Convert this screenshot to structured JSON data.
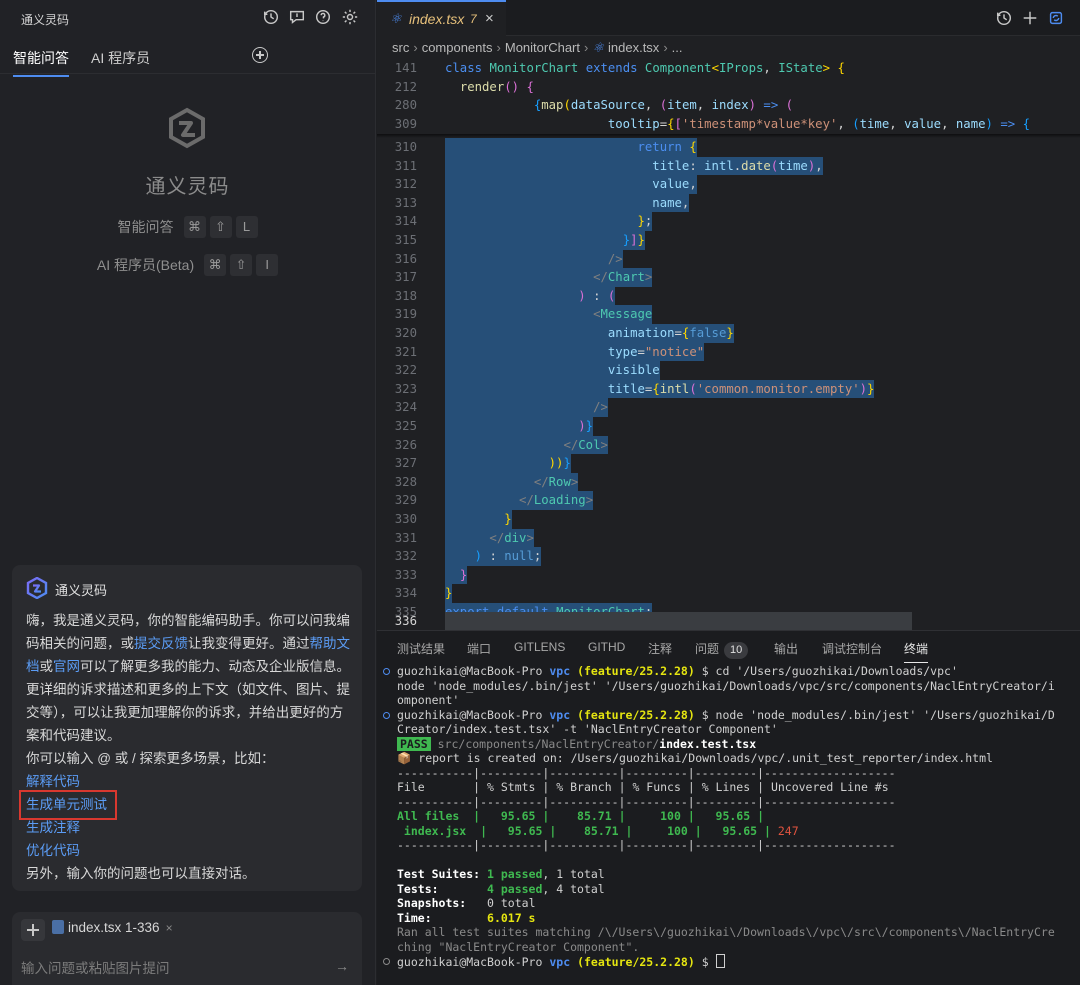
{
  "left_header": {
    "title": "通义灵码"
  },
  "left_tabs": [
    {
      "label": "智能问答"
    },
    {
      "label": "AI 程序员"
    }
  ],
  "welcome": {
    "title": "通义灵码",
    "shortcuts": [
      {
        "label": "智能问答",
        "keys": [
          "⌘",
          "⇧",
          "L"
        ]
      },
      {
        "label": "AI 程序员(Beta)",
        "keys": [
          "⌘",
          "⇧",
          "I"
        ]
      }
    ]
  },
  "chat": {
    "author": "通义灵码",
    "p1_a": "嗨，我是通义灵码，你的智能编码助手。你可以问我编码相关的问题，或",
    "p1_link1": "提交反馈",
    "p1_b": "让我变得更好。通过",
    "p1_link2": "帮助文档",
    "p1_c": "或",
    "p1_link3": "官网",
    "p1_d": "可以了解更多我的能力、动态及企业版信息。更详细的诉求描述和更多的上下文（如文件、图片、提交等），可以让我更加理解你的诉求，并给出更好的方案和代码建议。",
    "p2": "你可以输入 @ 或 / 探索更多场景，比如：",
    "suggestions": [
      "解释代码",
      "生成单元测试",
      "生成注释",
      "优化代码"
    ],
    "p3": "另外，输入你的问题也可以直接对话。"
  },
  "input": {
    "context_chip": "index.tsx 1-336",
    "chip_close": "×",
    "placeholder": "输入问题或粘贴图片提问",
    "send": "→"
  },
  "editor": {
    "tab_name": "index.tsx",
    "tab_problems": "7",
    "tab_close": "×",
    "breadcrumb": [
      "src",
      "components",
      "MonitorChart",
      "index.tsx",
      "..."
    ],
    "lines": [
      {
        "n": "141"
      },
      {
        "n": "212"
      },
      {
        "n": "280"
      },
      {
        "n": "309"
      },
      {
        "n": "310"
      },
      {
        "n": "311"
      },
      {
        "n": "312"
      },
      {
        "n": "313"
      },
      {
        "n": "314"
      },
      {
        "n": "315"
      },
      {
        "n": "316"
      },
      {
        "n": "317"
      },
      {
        "n": "318"
      },
      {
        "n": "319"
      },
      {
        "n": "320"
      },
      {
        "n": "321"
      },
      {
        "n": "322"
      },
      {
        "n": "323"
      },
      {
        "n": "324"
      },
      {
        "n": "325"
      },
      {
        "n": "326"
      },
      {
        "n": "327"
      },
      {
        "n": "328"
      },
      {
        "n": "329"
      },
      {
        "n": "330"
      },
      {
        "n": "331"
      },
      {
        "n": "332"
      },
      {
        "n": "333"
      },
      {
        "n": "334"
      },
      {
        "n": "335"
      },
      {
        "n": "336"
      }
    ]
  },
  "panel": {
    "tabs": [
      "测试结果",
      "端口",
      "GITLENS",
      "GITHD",
      "注释",
      "问题",
      "输出",
      "调试控制台",
      "终端"
    ],
    "problems_count": "10",
    "active_tab": "终端"
  },
  "terminal": {
    "user": "guozhikai@MacBook-Pro",
    "dir": "vpc",
    "branch": "(feature/25.2.28)",
    "cmd1": "$ cd '/Users/guozhikai/Downloads/vpc'",
    "cmd1_cont1": "node 'node_modules/.bin/jest' '/Users/guozhikai/Downloads/vpc/src/components/NaclEntryCreator/i",
    "cmd1_cont2": "omponent'",
    "cmd2": "$ node 'node_modules/.bin/jest' '/Users/guozhikai/D",
    "cmd2_cont": "Creator/index.test.tsx' -t 'NaclEntryCreator Component'",
    "pass_label": "PASS",
    "pass_path": "src/components/NaclEntryCreator/",
    "pass_file": "index.test.tsx",
    "report": "report is created on: /Users/guozhikai/Downloads/vpc/.unit_test_reporter/index.html",
    "coverage_headers": [
      "File",
      "% Stmts",
      "% Branch",
      "% Funcs",
      "% Lines",
      "Uncovered Line #s"
    ],
    "coverage_rows": [
      {
        "file": "All files",
        "stmts": "95.65",
        "branch": "85.71",
        "funcs": "100",
        "lines": "95.65",
        "uncovered": ""
      },
      {
        "file": " index.jsx",
        "stmts": "95.65",
        "branch": "85.71",
        "funcs": "100",
        "lines": "95.65",
        "uncovered": "247"
      }
    ],
    "suites_label": "Test Suites:",
    "suites_passed": "1 passed",
    "suites_total": ", 1 total",
    "tests_label": "Tests:",
    "tests_passed": "4 passed",
    "tests_total": ", 4 total",
    "snap_label": "Snapshots:",
    "snap_val": "0 total",
    "time_label": "Time:",
    "time_val": "6.017 s",
    "ran1": "Ran all test suites matching /\\/Users\\/guozhikai\\/Downloads\\/vpc\\/src\\/components\\/NaclEntryCre",
    "ran2": "ching \"NaclEntryCreator Component\".",
    "prompt_end": "$"
  }
}
